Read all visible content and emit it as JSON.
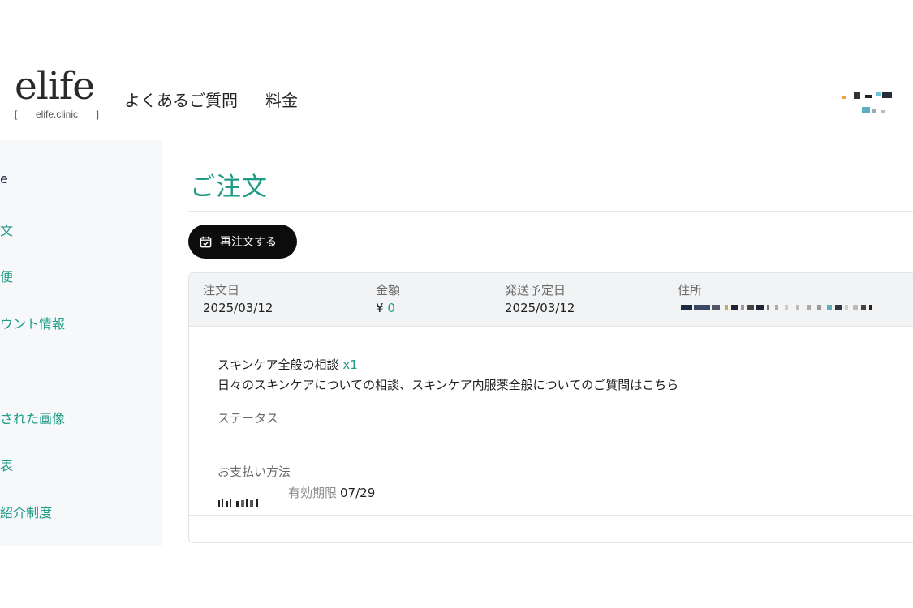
{
  "brand": {
    "logo_text": "elife",
    "domain_label": "elife.clinic"
  },
  "nav": {
    "items": [
      "よくあるご質問",
      "料金"
    ]
  },
  "sidebar": {
    "items": [
      "e",
      "文",
      "便",
      "ウント情報",
      "された画像",
      "表",
      "紹介制度"
    ]
  },
  "main": {
    "title": "ご注文",
    "reorder_button": "再注文する",
    "order": {
      "order_date_label": "注文日",
      "order_date": "2025/03/12",
      "amount_label": "金額",
      "amount_currency": "¥",
      "amount_value": "0",
      "ship_date_label": "発送予定日",
      "ship_date": "2025/03/12",
      "address_label": "住所",
      "item_name": "スキンケア全般の相談",
      "item_quantity": "x1",
      "item_description": "日々のスキンケアについての相談、スキンケア内服薬全般についてのご質問はこちら",
      "status_label": "ステータス",
      "payment_label": "お支払い方法",
      "expiry_label": "有効期限",
      "expiry_value": "07/29"
    }
  },
  "colors": {
    "accent": "#1f9b86",
    "button_bg": "#0c0c0c",
    "sidebar_bg": "#f7f8fa",
    "card_header_bg": "#f1f3f5"
  }
}
